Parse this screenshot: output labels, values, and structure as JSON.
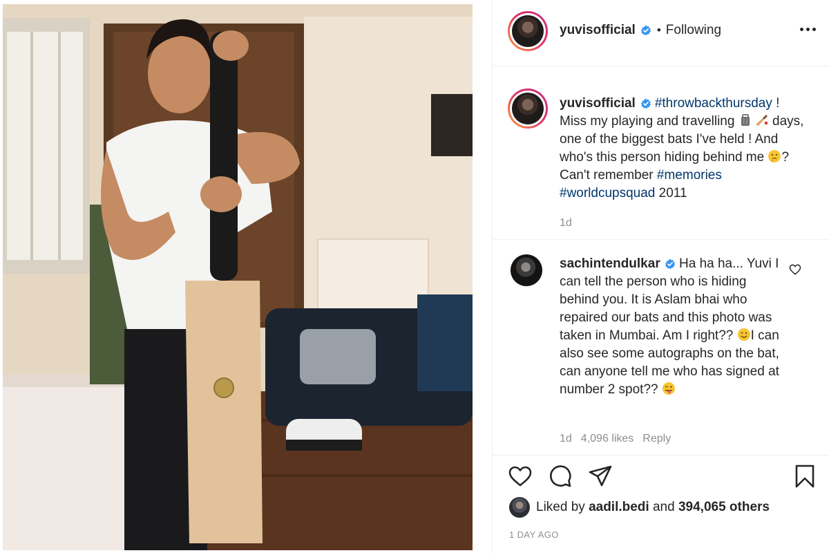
{
  "post": {
    "username": "yuvisofficial",
    "separator": "•",
    "follow_status": "Following",
    "caption": {
      "hashtag_1": "#throwbackthursday",
      "text_1": " ! Miss my playing and travelling ",
      "text_2": " days, one of the biggest bats I've held ! And who's this person hiding behind me ",
      "text_3": "? Can't remember ",
      "hashtag_2": "#memories",
      "hashtag_3": "#worldcupsquad",
      "text_4": " 2011",
      "age": "1d"
    },
    "comment": {
      "username": "sachintendulkar",
      "text_1": " Ha ha ha... Yuvi I can tell the person who is hiding behind you. It is Aslam bhai who repaired our bats and this photo was taken in Mumbai. Am I right?? ",
      "text_2": "I can also see some autographs on the bat, can anyone tell me who has signed at number 2 spot?? ",
      "age": "1d",
      "likes": "4,096 likes",
      "reply": "Reply"
    },
    "likes_line": {
      "prefix": "Liked by ",
      "liker": "aadil.bedi",
      "middle": " and ",
      "others": "394,065 others"
    },
    "timestamp": "1 DAY AGO"
  },
  "icons": {
    "verified": "verified-badge-icon",
    "more": "more-options-icon",
    "like": "heart-icon",
    "comment": "comment-bubble-icon",
    "share": "paper-plane-icon",
    "save": "bookmark-icon"
  },
  "colors": {
    "verified": "#3897f0",
    "hashtag": "#00376b",
    "muted": "#8e8e8e",
    "text": "#262626"
  }
}
